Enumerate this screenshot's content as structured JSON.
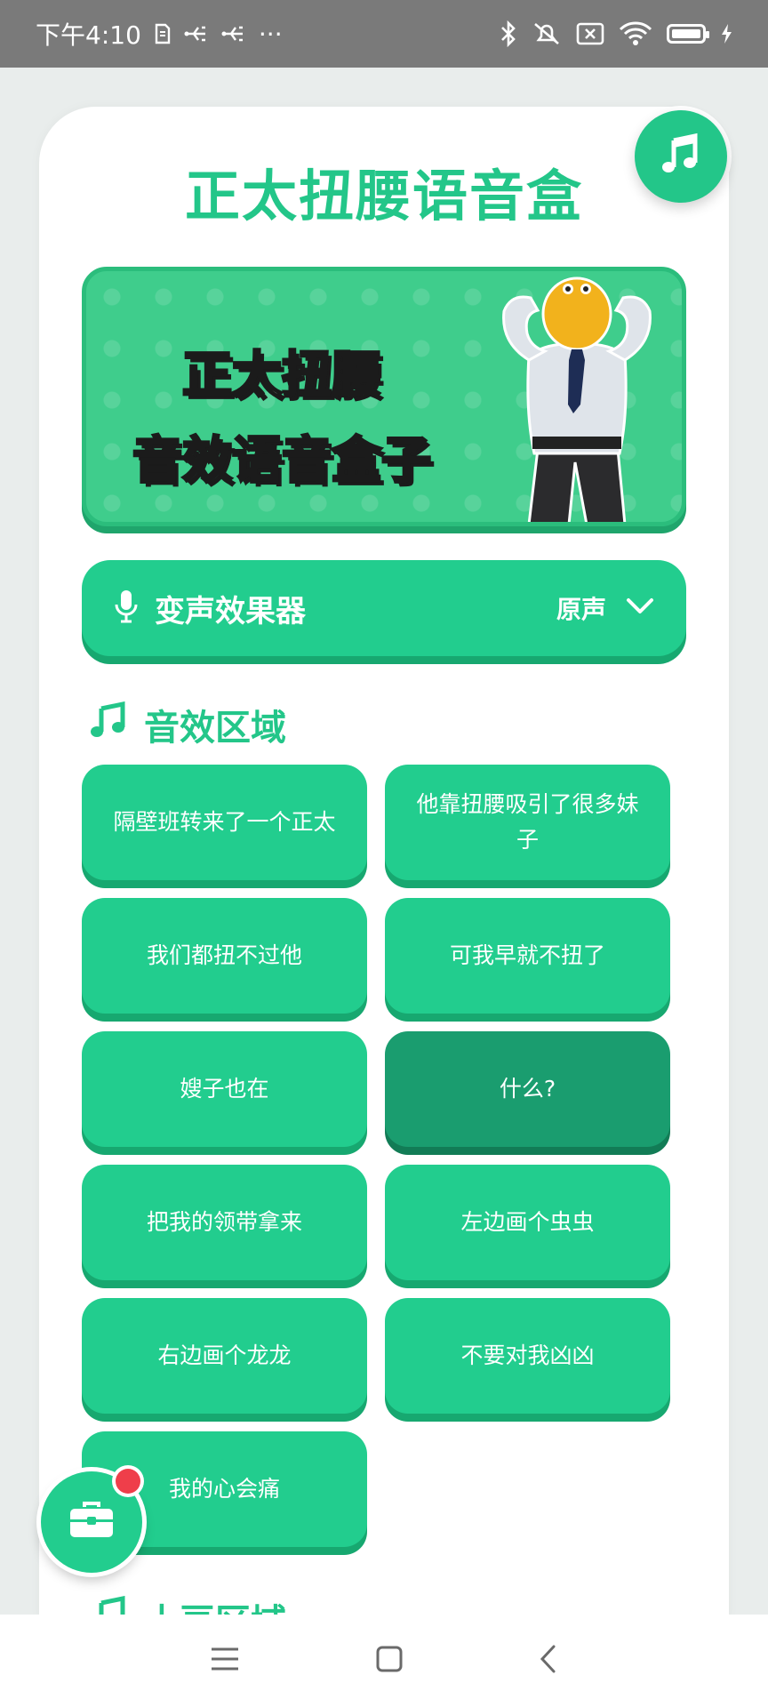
{
  "status_bar": {
    "time": "下午4:10",
    "more": "···"
  },
  "header": {
    "title": "正太扭腰语音盒",
    "music_icon": "music-note-icon"
  },
  "banner": {
    "line1": "正太扭腰",
    "line2": "音效语音盒子"
  },
  "voice_changer": {
    "label": "变声效果器",
    "value": "原声"
  },
  "sound_section": {
    "title": "音效区域",
    "buttons": [
      "隔壁班转来了一个正太",
      "他靠扭腰吸引了很多妹子",
      "我们都扭不过他",
      "可我早就不扭了",
      "嫂子也在",
      "什么?",
      "把我的领带拿来",
      "左边画个虫虫",
      "右边画个龙龙",
      "不要对我凶凶",
      "我的心会痛"
    ],
    "active_index": 5
  },
  "next_section": {
    "title": "土豆区域"
  },
  "colors": {
    "accent": "#23c689",
    "button": "#22cd8e",
    "button_active": "#1a9d6f",
    "badge": "#ef3e4a"
  }
}
